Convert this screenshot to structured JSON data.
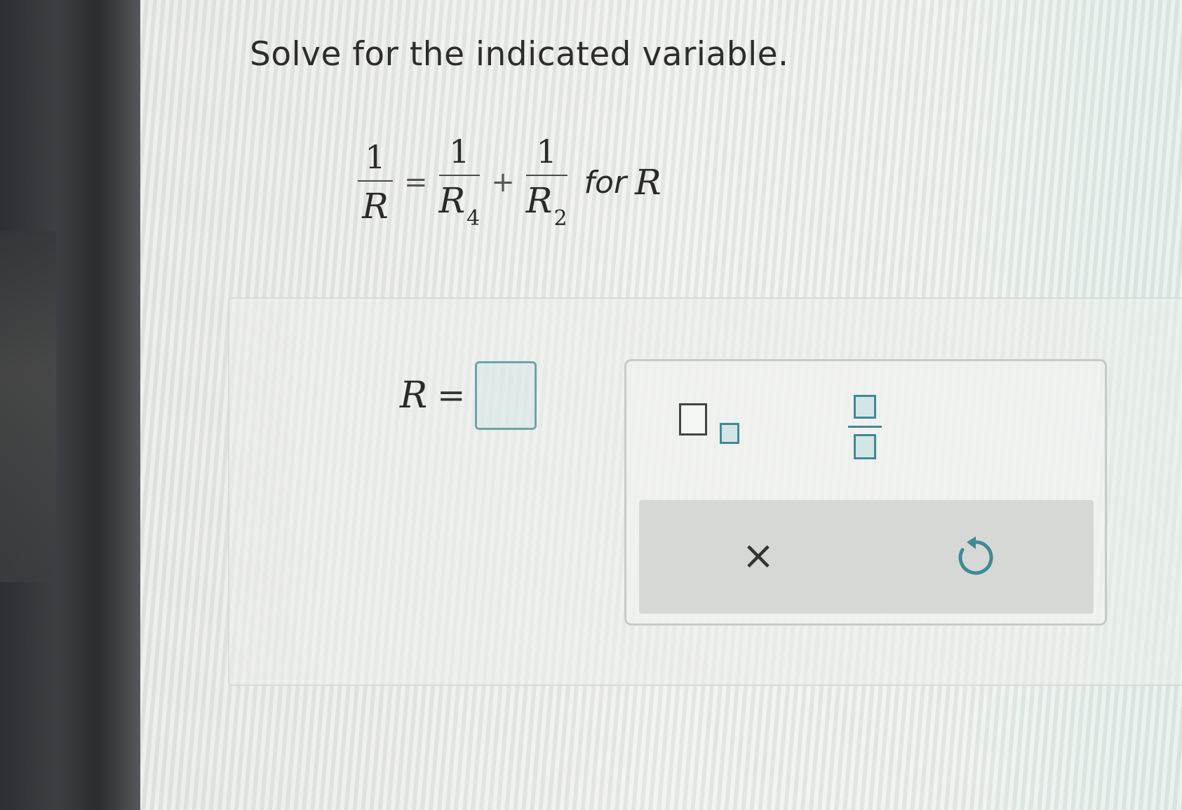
{
  "instruction": "Solve for the indicated variable.",
  "equation": {
    "lhs_num": "1",
    "lhs_den": "R",
    "equals": "=",
    "term1_num": "1",
    "term1_den": "R",
    "term1_sub": "4",
    "plus": "+",
    "term2_num": "1",
    "term2_den": "R",
    "term2_sub": "2",
    "for_text": "for",
    "for_var": "R"
  },
  "answer": {
    "lhs": "R",
    "equals": "=",
    "value": ""
  },
  "palette": {
    "tools": [
      "subscript-template",
      "fraction-template"
    ],
    "actions": {
      "clear_label": "×",
      "undo_icon": "undo-icon"
    }
  },
  "colors": {
    "accent": "#3f8a95",
    "input_border": "#6fa3ab",
    "action_bar": "#d6d8d5"
  }
}
